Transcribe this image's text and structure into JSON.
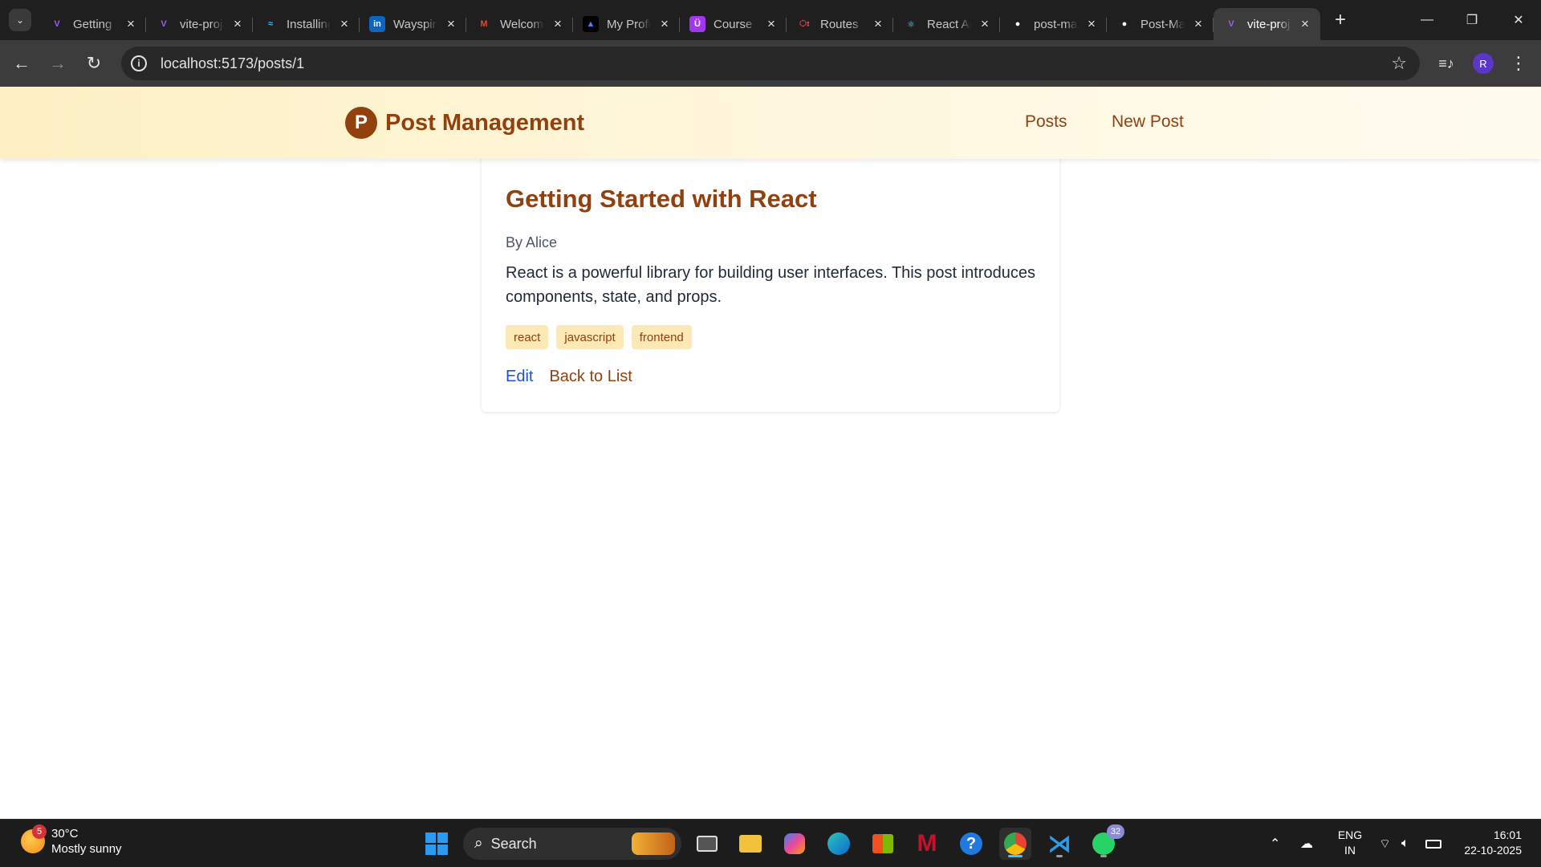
{
  "browser": {
    "tabs": [
      {
        "title": "Getting Started",
        "favicon": "vite-icon",
        "fav_glyph": "V",
        "fav_color": "#a855f7",
        "fav_bg": "transparent",
        "active": false
      },
      {
        "title": "vite-project",
        "favicon": "vite-icon",
        "fav_glyph": "V",
        "fav_color": "#a855f7",
        "fav_bg": "transparent",
        "active": false
      },
      {
        "title": "Installing",
        "favicon": "tailwind-icon",
        "fav_glyph": "≈",
        "fav_color": "#38bdf8",
        "fav_bg": "transparent",
        "active": false
      },
      {
        "title": "Wayspire",
        "favicon": "linkedin-icon",
        "fav_glyph": "in",
        "fav_color": "#ffffff",
        "fav_bg": "#0a66c2",
        "active": false
      },
      {
        "title": "Welcome",
        "favicon": "gmail-icon",
        "fav_glyph": "M",
        "fav_color": "#ea4335",
        "fav_bg": "transparent",
        "active": false
      },
      {
        "title": "My Profile",
        "favicon": "profile-icon",
        "fav_glyph": "▲",
        "fav_color": "#4f7cff",
        "fav_bg": "#000000",
        "active": false
      },
      {
        "title": "Course",
        "favicon": "udemy-icon",
        "fav_glyph": "Ü",
        "fav_color": "#ffffff",
        "fav_bg": "#a435f0",
        "active": false
      },
      {
        "title": "Routes",
        "favicon": "react-router-icon",
        "fav_glyph": "ഃ",
        "fav_color": "#f44250",
        "fav_bg": "transparent",
        "active": false
      },
      {
        "title": "React App",
        "favicon": "react-icon",
        "fav_glyph": "⚛",
        "fav_color": "#61dafb",
        "fav_bg": "transparent",
        "active": false
      },
      {
        "title": "post-management",
        "favicon": "github-icon",
        "fav_glyph": "●",
        "fav_color": "#ffffff",
        "fav_bg": "transparent",
        "active": false
      },
      {
        "title": "Post-Management",
        "favicon": "github-icon",
        "fav_glyph": "●",
        "fav_color": "#ffffff",
        "fav_bg": "transparent",
        "active": false
      },
      {
        "title": "vite-project",
        "favicon": "vite-icon",
        "fav_glyph": "V",
        "fav_color": "#a855f7",
        "fav_bg": "transparent",
        "active": true
      }
    ],
    "url": "localhost:5173/posts/1",
    "profile_initial": "R"
  },
  "app": {
    "brand_letter": "P",
    "brand_name": "Post Management",
    "nav": {
      "posts": "Posts",
      "new_post": "New Post"
    },
    "accent_color": "#92400e"
  },
  "post": {
    "title": "Getting Started with React",
    "author": "By Alice",
    "body": "React is a powerful library for building user interfaces. This post introduces components, state, and props.",
    "tags": [
      "react",
      "javascript",
      "frontend"
    ],
    "edit_label": "Edit",
    "back_label": "Back to List"
  },
  "taskbar": {
    "weather_badge": "5",
    "temperature": "30°C",
    "condition": "Mostly sunny",
    "search_label": "Search",
    "whatsapp_badge": "32",
    "lang_line1": "ENG",
    "lang_line2": "IN",
    "time": "16:01",
    "date": "22-10-2025"
  }
}
